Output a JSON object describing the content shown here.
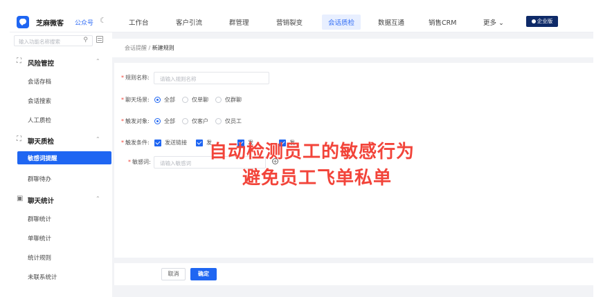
{
  "header": {
    "brand": "芝麻微客",
    "channel": "公众号",
    "nav": [
      "工作台",
      "客户引流",
      "群管理",
      "营销裂变",
      "会话质检",
      "数据互通",
      "销售CRM",
      "更多"
    ],
    "active_nav": "会话质检",
    "enterprise_badge": "企业版"
  },
  "sidebar": {
    "search_placeholder": "输入功能名称搜索",
    "groups": [
      {
        "label": "风险管控",
        "items": [
          "会话存档",
          "会话搜索",
          "人工质检"
        ]
      },
      {
        "label": "聊天质检",
        "items": [
          "敏感词提醒",
          "群聊待办"
        ]
      },
      {
        "label": "聊天统计",
        "items": [
          "群聊统计",
          "单聊统计",
          "统计规则",
          "未联系统计"
        ]
      }
    ],
    "active_item": "敏感词提醒"
  },
  "breadcrumb": {
    "parent": "会话提醒",
    "separator": "/",
    "current": "新建规则"
  },
  "form": {
    "rule_name_label": "规则名称:",
    "rule_name_placeholder": "请输入规则名称",
    "scene_label": "聊天场景:",
    "scene_options": [
      "全部",
      "仅单聊",
      "仅群聊"
    ],
    "scene_selected": "全部",
    "target_label": "触发对象:",
    "target_options": [
      "全部",
      "仅客户",
      "仅员工"
    ],
    "target_selected": "全部",
    "condition_label": "触发条件:",
    "conditions": [
      "发送链接",
      "发",
      "发",
      "发"
    ],
    "sensitive_label": "敏感词:",
    "sensitive_placeholder": "请输入敏感词"
  },
  "actions": {
    "cancel": "取消",
    "confirm": "确定"
  },
  "overlay": {
    "line1": "自动检测员工的敏感行为",
    "line2": "避免员工飞单私单"
  },
  "colors": {
    "primary": "#1f66f2",
    "overlay": "#f2443a",
    "required": "#f0453a"
  }
}
